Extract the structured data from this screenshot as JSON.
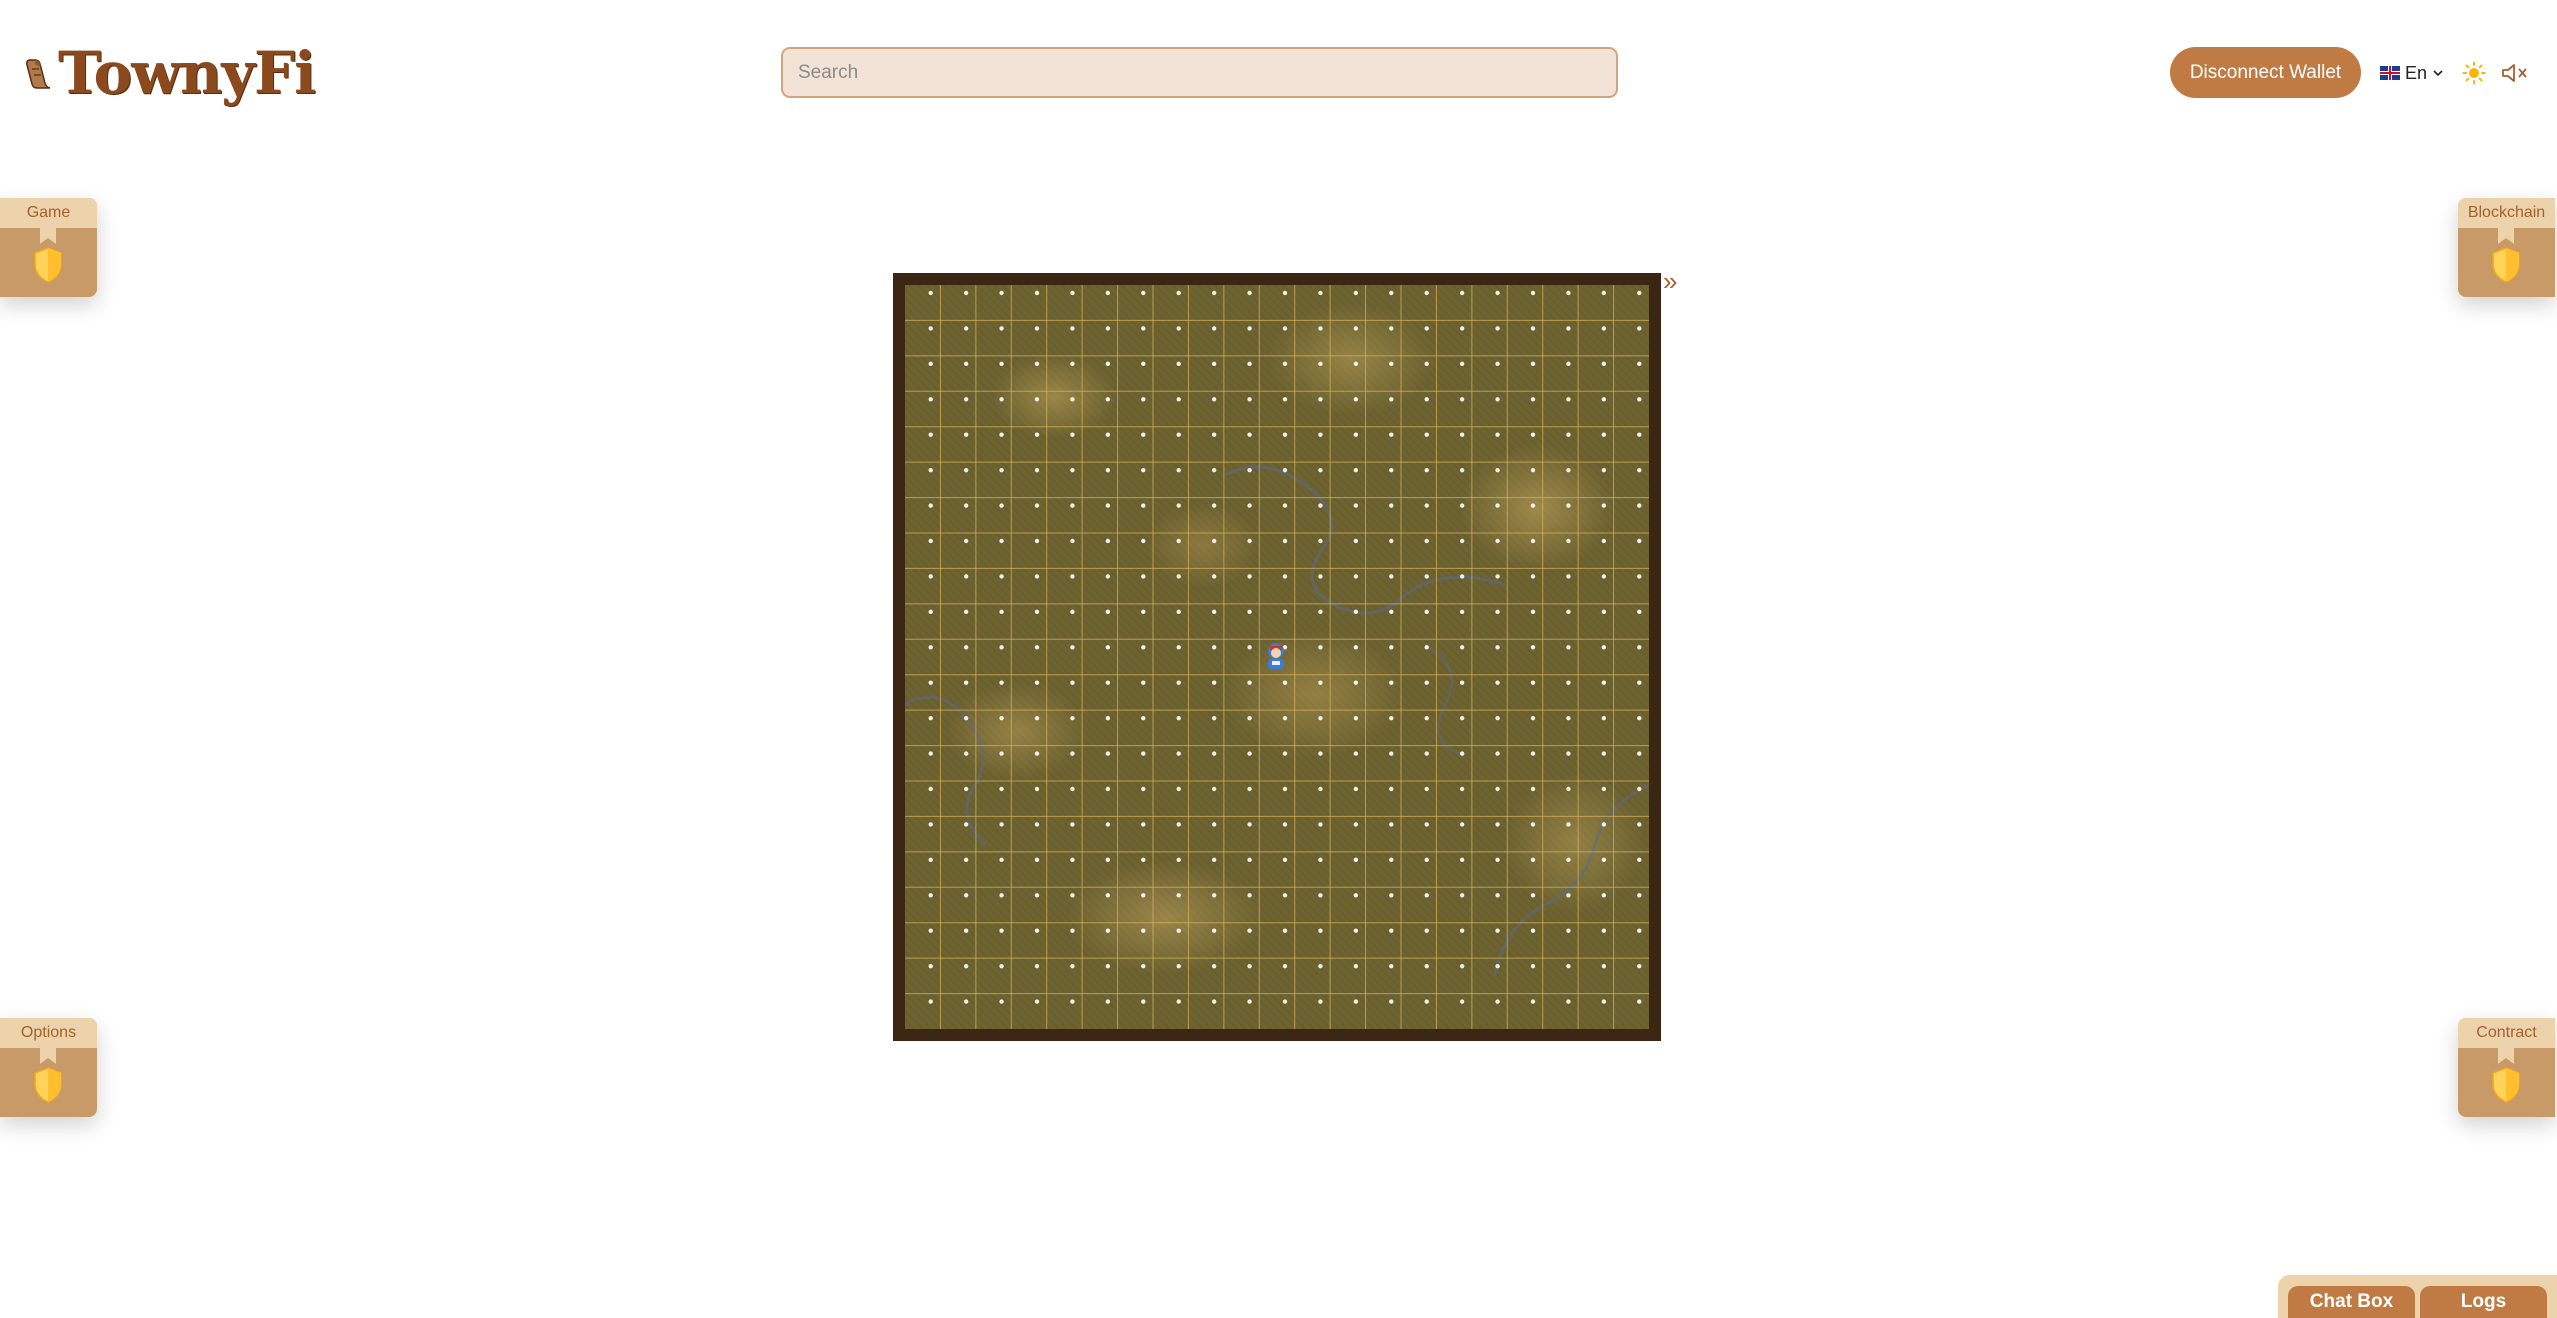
{
  "header": {
    "logo_text": "TownyFi",
    "search": {
      "placeholder": "Search",
      "value": ""
    },
    "disconnect_label": "Disconnect Wallet",
    "language": "En",
    "icons": [
      "scroll-icon",
      "uk-flag-icon",
      "chevron-down-icon",
      "sun-icon",
      "mute-icon"
    ]
  },
  "side_tabs": {
    "game": "Game",
    "blockchain": "Blockchain",
    "options": "Options",
    "contract": "Contract"
  },
  "map": {
    "grid_cols": 21,
    "grid_rows": 21,
    "expand_icon": "»",
    "colors": {
      "frame": "#3b2614",
      "grid": "#d8b15a",
      "accent": "#c07b44"
    }
  },
  "bottom": {
    "chat_label": "Chat Box",
    "logs_label": "Logs"
  }
}
